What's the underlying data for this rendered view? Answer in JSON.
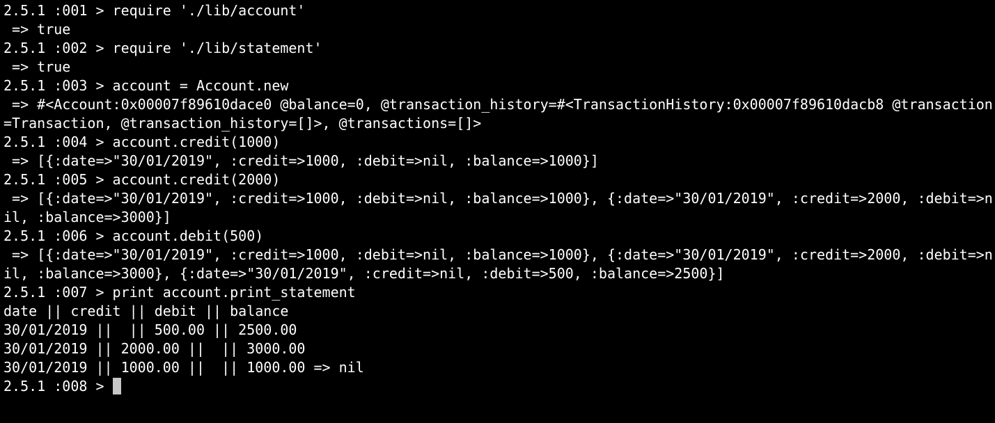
{
  "terminal": {
    "lines": [
      "2.5.1 :001 > require './lib/account'",
      " => true",
      "2.5.1 :002 > require './lib/statement'",
      " => true",
      "2.5.1 :003 > account = Account.new",
      " => #<Account:0x00007f89610dace0 @balance=0, @transaction_history=#<TransactionHistory:0x00007f89610dacb8 @transaction",
      "=Transaction, @transaction_history=[]>, @transactions=[]>",
      "2.5.1 :004 > account.credit(1000)",
      " => [{:date=>\"30/01/2019\", :credit=>1000, :debit=>nil, :balance=>1000}]",
      "2.5.1 :005 > account.credit(2000)",
      " => [{:date=>\"30/01/2019\", :credit=>1000, :debit=>nil, :balance=>1000}, {:date=>\"30/01/2019\", :credit=>2000, :debit=>n",
      "il, :balance=>3000}]",
      "2.5.1 :006 > account.debit(500)",
      " => [{:date=>\"30/01/2019\", :credit=>1000, :debit=>nil, :balance=>1000}, {:date=>\"30/01/2019\", :credit=>2000, :debit=>n",
      "il, :balance=>3000}, {:date=>\"30/01/2019\", :credit=>nil, :debit=>500, :balance=>2500}]",
      "2.5.1 :007 > print account.print_statement",
      "date || credit || debit || balance",
      "30/01/2019 ||  || 500.00 || 2500.00",
      "30/01/2019 || 2000.00 ||  || 3000.00",
      "30/01/2019 || 1000.00 ||  || 1000.00 => nil"
    ],
    "prompt": "2.5.1 :008 > ",
    "colors": {
      "background": "#000000",
      "foreground": "#ffffff",
      "cursor": "#c7c7c7"
    }
  }
}
